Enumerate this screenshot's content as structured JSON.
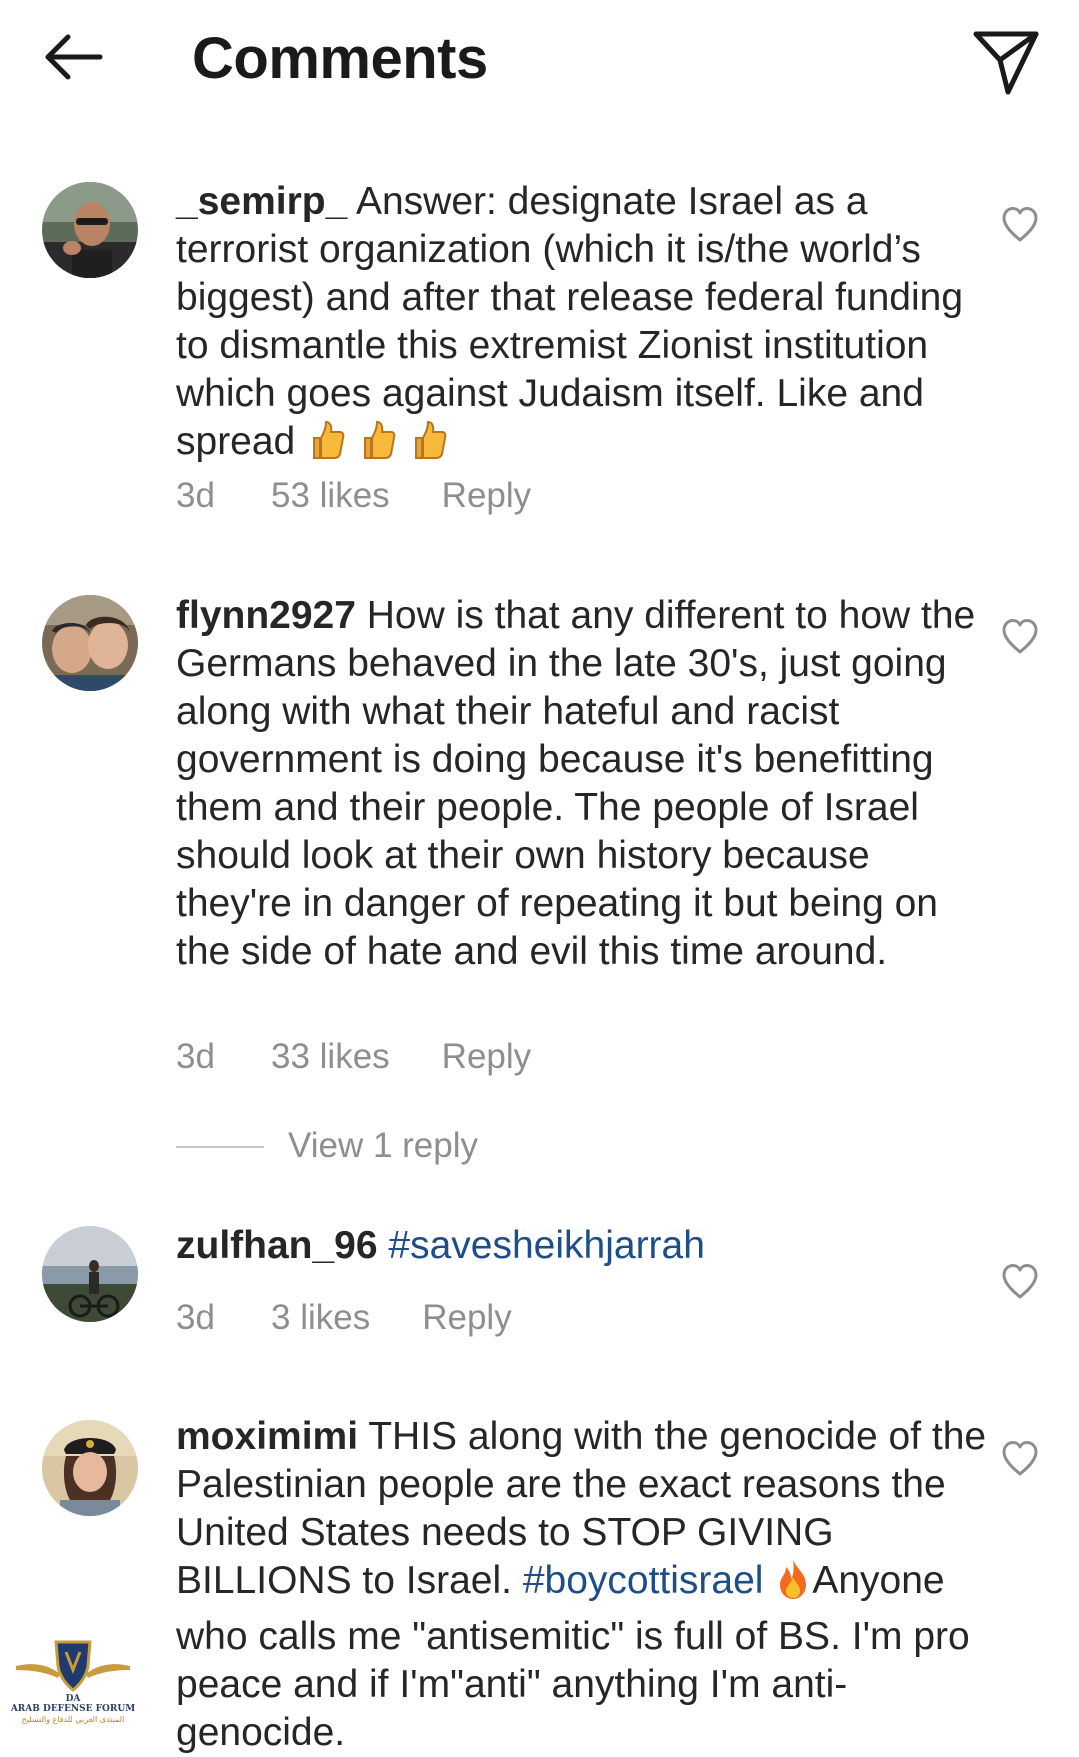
{
  "header": {
    "title": "Comments",
    "back_icon": "arrow-left-icon",
    "share_icon": "paper-plane-icon"
  },
  "comments": [
    {
      "username": "_semirp_",
      "text": "Answer: designate Israel as a terrorist organization (which it is/the world’s biggest) and after that release federal funding to dismantle this extremist Zionist institution which goes against Judaism itself. Like and spread",
      "emoji": "thumbs-up-icon ×3",
      "time": "3d",
      "likes": "53 likes",
      "reply_label": "Reply"
    },
    {
      "username": "flynn2927",
      "text": "How is that any different to how the Germans behaved in the late 30's, just going along with what their hateful and racist government is doing because it's benefitting them and their people. The people of Israel should look at their own history because they're in danger of repeating it but being on the side of hate and evil this time around.",
      "time": "3d",
      "likes": "33 likes",
      "reply_label": "Reply",
      "view_replies": "View 1 reply"
    },
    {
      "username": "zulfhan_96",
      "hashtag": "#savesheikhjarrah",
      "time": "3d",
      "likes": "3 likes",
      "reply_label": "Reply"
    },
    {
      "username": "moximimi",
      "text_before_tag": "THIS along with the genocide of the Palestinian people are the exact reasons  the United States needs to STOP GIVING BILLIONS to Israel.",
      "hashtag": "#boycottisrael",
      "emoji": "fire-icon",
      "text_after_tag": "Anyone who calls me \"antisemitic\" is full of BS. I'm pro peace and if I'm\"anti\" anything I'm anti-genocide."
    }
  ],
  "watermark": {
    "abbr": "DA",
    "name": "ARAB DEFENSE FORUM",
    "arabic": "المنتدى العربي للدفاع والتسليح"
  },
  "colors": {
    "text": "#262626",
    "meta": "#8e8e8e",
    "hashtag": "#1d4e89",
    "background": "#ffffff"
  }
}
